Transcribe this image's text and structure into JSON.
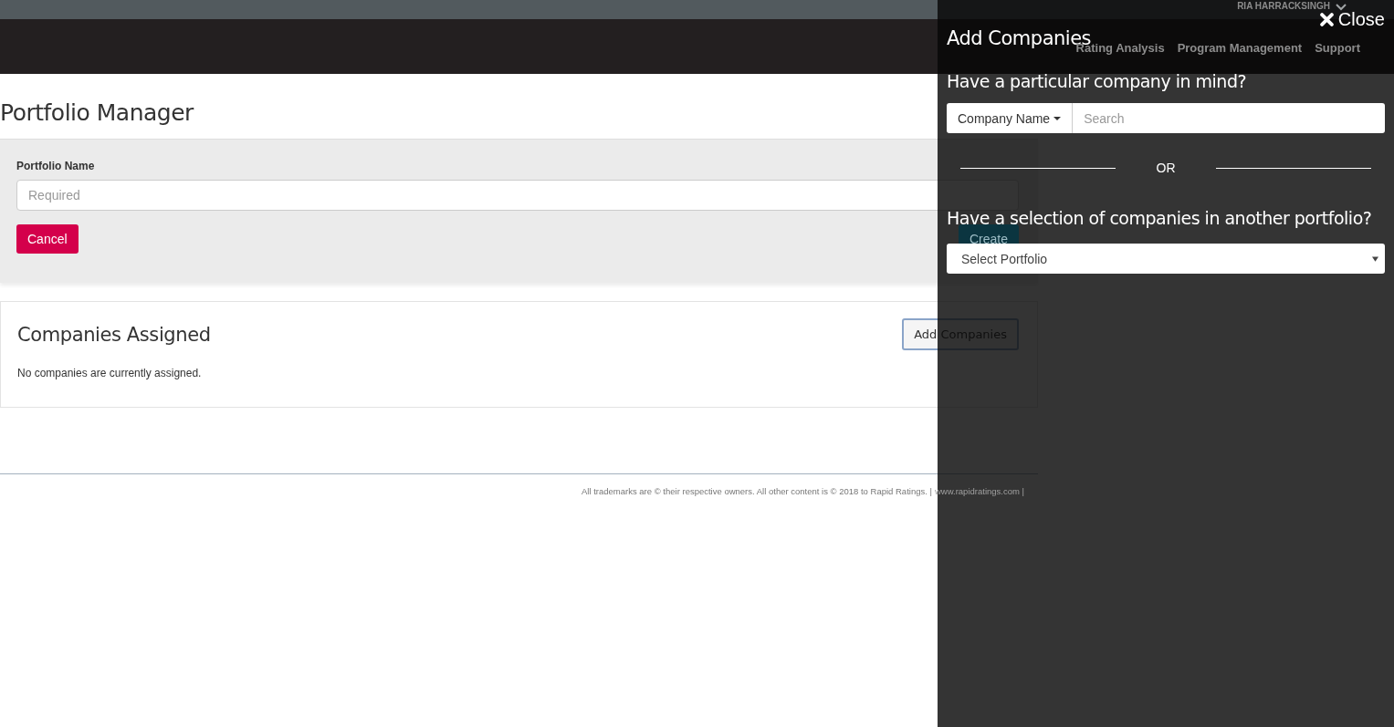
{
  "top_bar": {
    "user_name": "RIA HARRACKSINGH"
  },
  "nav": {
    "items": [
      {
        "label": "Rating Analysis"
      },
      {
        "label": "Program Management"
      },
      {
        "label": "Support"
      }
    ]
  },
  "page": {
    "title": "Portfolio Manager",
    "form": {
      "label": "Portfolio Name",
      "placeholder": "Required",
      "buttons": [
        {
          "label": "Cancel",
          "kind": "danger"
        },
        {
          "label": "Create",
          "kind": "primary"
        }
      ]
    },
    "companies": {
      "title": "Companies Assigned",
      "add_button": "Add Companies",
      "empty_text": "No companies are currently assigned."
    }
  },
  "footer": {
    "text": "All trademarks are © their respective owners. All other content is © 2018 to Rapid Ratings. |",
    "link": "www.rapidratings.com |"
  },
  "drawer": {
    "title": "Add Companies",
    "close": "Close",
    "question_1": "Have a particular company in mind?",
    "search": {
      "type_button": "Company Name",
      "placeholder": "Search"
    },
    "divider": "OR",
    "question_2": "Have a selection of companies in another portfolio?",
    "select": {
      "value": "Select Portfolio"
    }
  }
}
